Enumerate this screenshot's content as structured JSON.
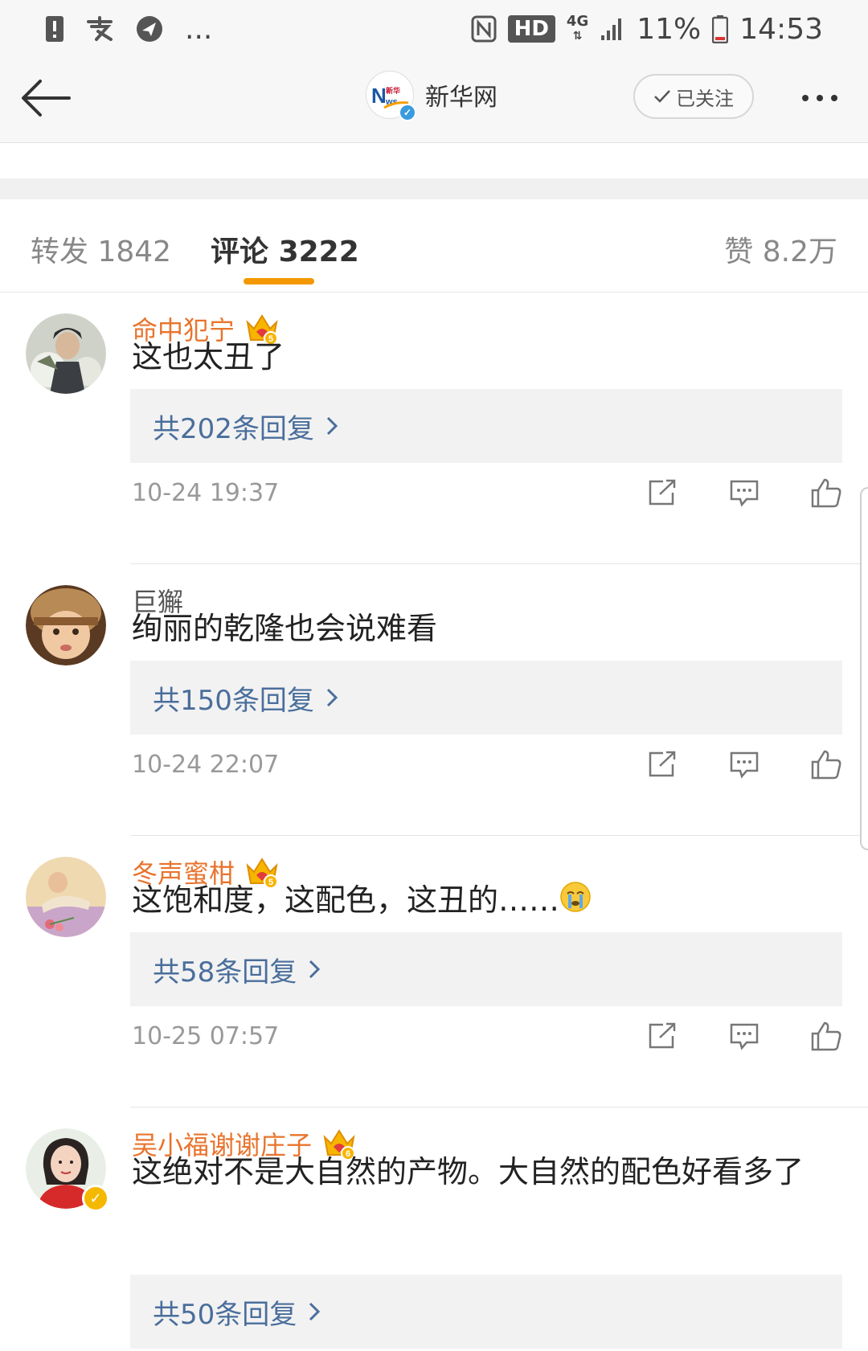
{
  "status_bar": {
    "battery_text": "11%",
    "time": "14:53",
    "hd_label": "HD",
    "network_label": "4G",
    "dots": "..."
  },
  "header": {
    "account_name": "新华网",
    "follow_label": "已关注"
  },
  "tabs": {
    "repost_label": "转发",
    "repost_count": "1842",
    "comment_label": "评论",
    "comment_count": "3222",
    "like_label": "赞",
    "like_count": "8.2万"
  },
  "comments": [
    {
      "username": "命中犯宁",
      "vip_level": "5",
      "text": "这也太丑了",
      "replies": "共202条回复",
      "time": "10-24 19:37"
    },
    {
      "username": "巨獬",
      "text": "绚丽的乾隆也会说难看",
      "replies": "共150条回复",
      "time": "10-24 22:07"
    },
    {
      "username": "冬声蜜柑",
      "vip_level": "5",
      "text": "这饱和度，这配色，这丑的……",
      "replies": "共58条回复",
      "time": "10-25 07:57"
    },
    {
      "username": "吴小福谢谢庄子",
      "vip_level": "6",
      "text": "这绝对不是大自然的产物。大自然的配色好看多了",
      "replies": "共50条回复"
    }
  ],
  "colors": {
    "username_vip": "#e8742d",
    "reply_link": "#4a6e9c",
    "tab_indicator": "#f39800"
  }
}
